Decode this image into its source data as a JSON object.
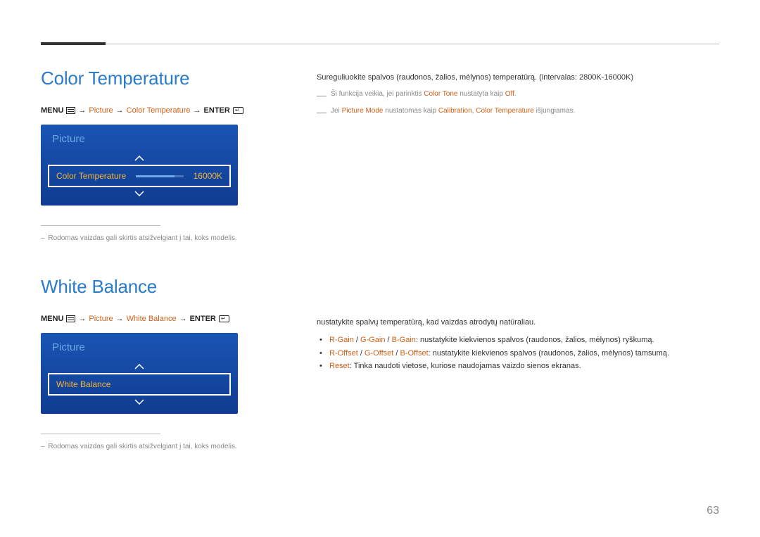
{
  "page_number": "63",
  "section1": {
    "title": "Color Temperature",
    "breadcrumb": {
      "menu": "MENU",
      "picture": "Picture",
      "item": "Color Temperature",
      "enter": "ENTER",
      "arrow": "→"
    },
    "osd": {
      "panel_title": "Picture",
      "row_label": "Color Temperature",
      "row_value": "16000K"
    },
    "note": "Rodomas vaizdas gali skirtis atsižvelgiant į tai, koks modelis."
  },
  "section2": {
    "title": "White Balance",
    "breadcrumb": {
      "menu": "MENU",
      "picture": "Picture",
      "item": "White Balance",
      "enter": "ENTER",
      "arrow": "→"
    },
    "osd": {
      "panel_title": "Picture",
      "row_label": "White Balance"
    },
    "note": "Rodomas vaizdas gali skirtis atsižvelgiant į tai, koks modelis."
  },
  "right1": {
    "intro": "Sureguliuokite spalvos (raudonos, žalios, mėlynos) temperatūrą. (intervalas: 2800K-16000K)",
    "dash1_pre": "Ši funkcija veikia, jei parinktis ",
    "dash1_a": "Color Tone",
    "dash1_mid": " nustatyta kaip ",
    "dash1_b": "Off",
    "dash1_post": ".",
    "dash2_pre": "Jei ",
    "dash2_a": "Picture Mode",
    "dash2_mid1": " nustatomas kaip ",
    "dash2_b": "Calibration",
    "dash2_mid2": ", ",
    "dash2_c": "Color Temperature",
    "dash2_post": " išjungiamas."
  },
  "right2": {
    "intro": "nustatykite spalvų temperatūrą, kad vaizdas atrodytų natūraliau.",
    "b1_r": "R-Gain",
    "b1_g": "G-Gain",
    "b1_b": "B-Gain",
    "b1_rest": ": nustatykite kiekvienos spalvos (raudonos, žalios, mėlynos) ryškumą.",
    "b2_r": "R-Offset",
    "b2_g": "G-Offset",
    "b2_b": "B-Offset",
    "b2_rest": ": nustatykite kiekvienos spalvos (raudonos, žalios, mėlynos) tamsumą.",
    "b3_a": "Reset",
    "b3_rest": ": Tinka naudoti vietose, kuriose naudojamas vaizdo sienos ekranas.",
    "sep": " / "
  }
}
